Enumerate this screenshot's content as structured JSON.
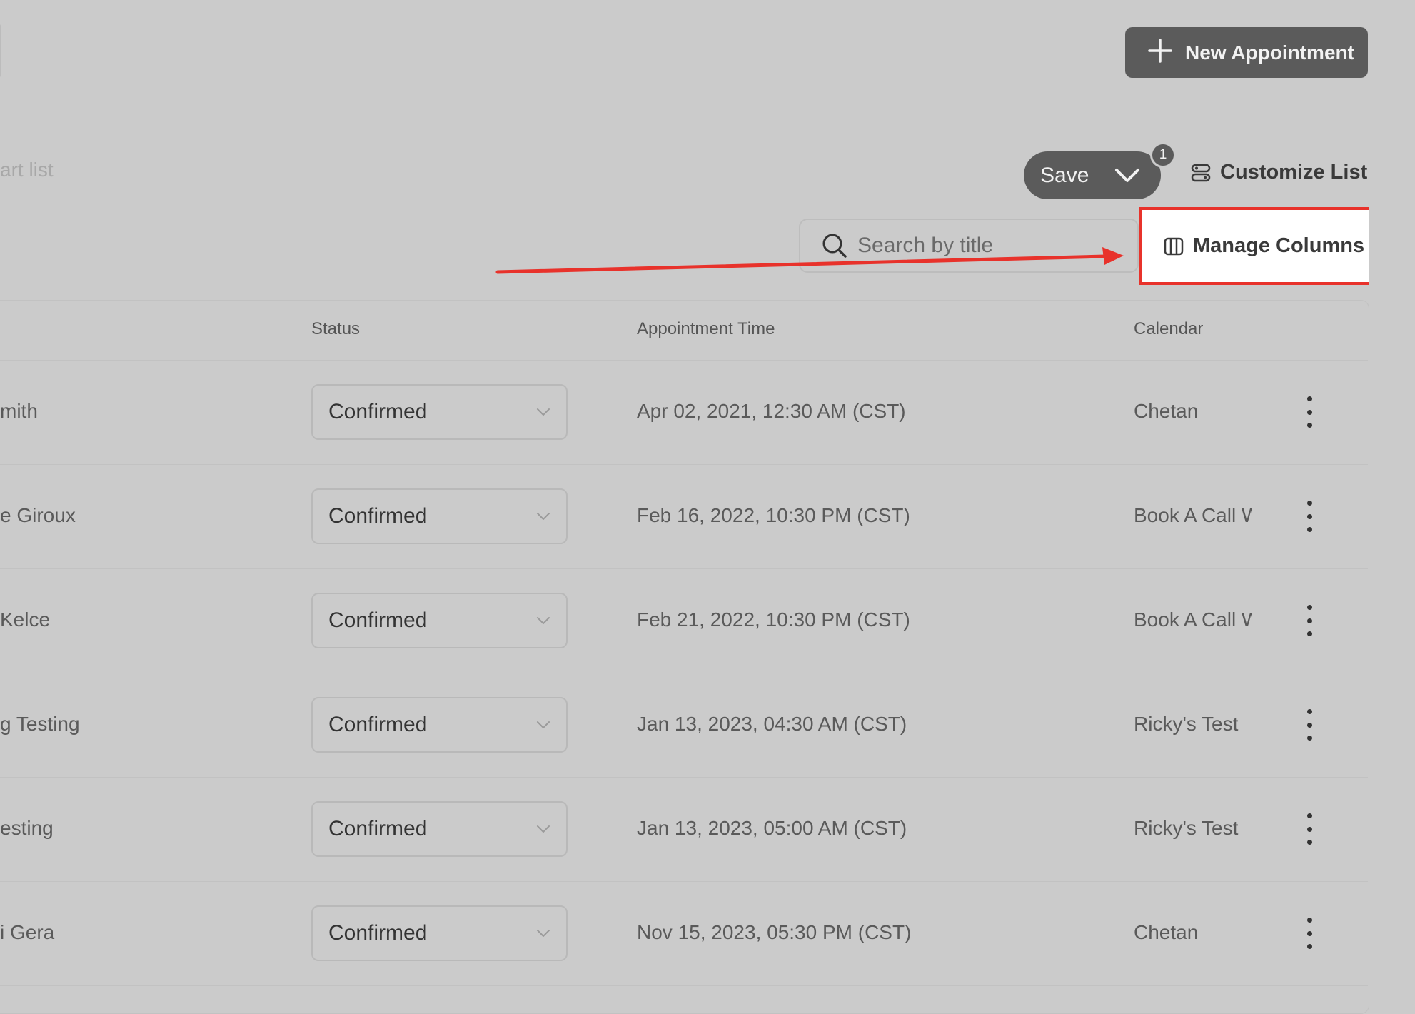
{
  "header": {
    "new_appointment_label": "New Appointment",
    "chart_list_label": "art list",
    "save_label": "Save",
    "badge_count": "1",
    "customize_list_label": "Customize List"
  },
  "toolbar": {
    "search_placeholder": "Search by title",
    "manage_columns_label": "Manage Columns"
  },
  "table": {
    "columns": [
      "Status",
      "Appointment Time",
      "Calendar"
    ],
    "rows": [
      {
        "name": "mith",
        "status": "Confirmed",
        "time": "Apr 02, 2021, 12:30 AM (CST)",
        "calendar": "Chetan"
      },
      {
        "name": "e Giroux",
        "status": "Confirmed",
        "time": "Feb 16, 2022, 10:30 PM (CST)",
        "calendar": "Book A Call With"
      },
      {
        "name": " Kelce",
        "status": "Confirmed",
        "time": "Feb 21, 2022, 10:30 PM (CST)",
        "calendar": "Book A Call With"
      },
      {
        "name": "g Testing",
        "status": "Confirmed",
        "time": "Jan 13, 2023, 04:30 AM (CST)",
        "calendar": "Ricky's Test"
      },
      {
        "name": "esting",
        "status": "Confirmed",
        "time": "Jan 13, 2023, 05:00 AM (CST)",
        "calendar": "Ricky's Test"
      },
      {
        "name": "i Gera",
        "status": "Confirmed",
        "time": "Nov 15, 2023, 05:30 PM (CST)",
        "calendar": "Chetan"
      }
    ]
  },
  "colors": {
    "background": "#cbcbcb",
    "dark_button": "#5b5b5b",
    "highlight": "#e8322b"
  }
}
